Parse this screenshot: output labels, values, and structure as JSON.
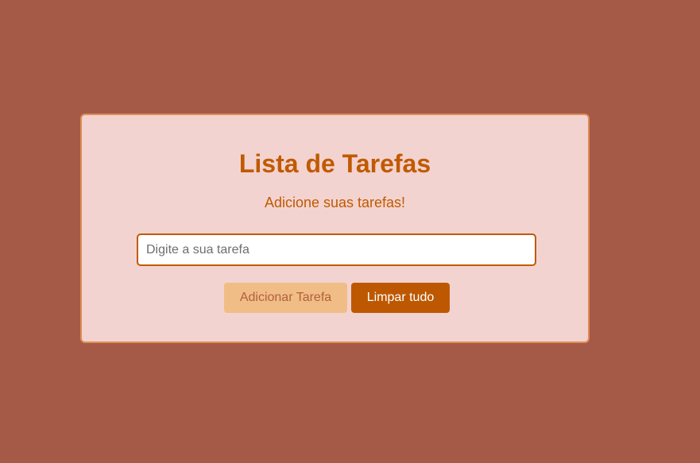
{
  "card": {
    "title": "Lista de Tarefas",
    "subtitle": "Adicione suas tarefas!"
  },
  "task_input": {
    "value": "",
    "placeholder": "Digite a sua tarefa"
  },
  "buttons": {
    "add_label": "Adicionar Tarefa",
    "clear_label": "Limpar tudo"
  },
  "colors": {
    "page_background": "#a55a48",
    "card_background": "#f3d3d0",
    "card_border": "#de8d57",
    "accent": "#c05a00",
    "add_button_background": "#f0bd86",
    "clear_button_background": "#bd5800"
  }
}
